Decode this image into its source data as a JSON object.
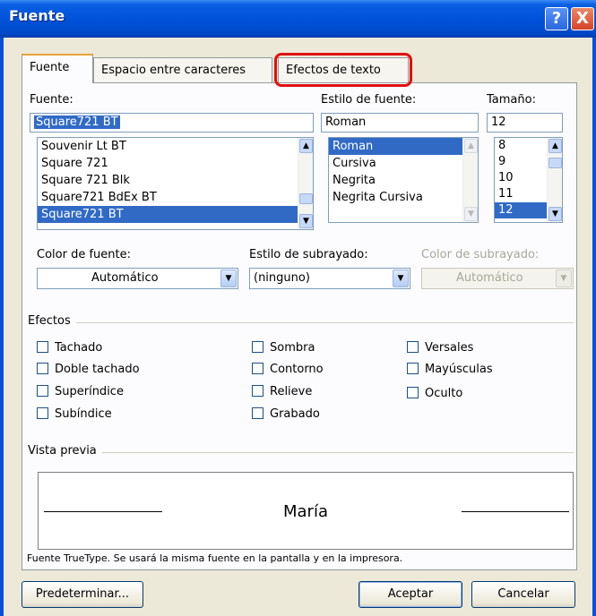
{
  "window": {
    "title": "Fuente"
  },
  "titlebar_buttons": {
    "help": "?",
    "close": "X"
  },
  "tabs": [
    {
      "label": "Fuente",
      "active": true
    },
    {
      "label": "Espacio entre caracteres",
      "active": false
    },
    {
      "label": "Efectos de texto",
      "active": false,
      "highlighted": true
    }
  ],
  "font": {
    "label": "Fuente:",
    "value": "Square721 BT",
    "items": [
      "Souvenir Lt BT",
      "Square 721",
      "Square 721 Blk",
      "Square721 BdEx BT",
      "Square721 BT"
    ],
    "selected": "Square721 BT"
  },
  "style": {
    "label": "Estilo de fuente:",
    "value": "Roman",
    "items": [
      "Roman",
      "Cursiva",
      "Negrita",
      "Negrita Cursiva"
    ],
    "selected": "Roman"
  },
  "size": {
    "label": "Tamaño:",
    "value": "12",
    "items": [
      "8",
      "9",
      "10",
      "11",
      "12"
    ],
    "selected": "12"
  },
  "font_color": {
    "label": "Color de fuente:",
    "value": "Automático"
  },
  "underline_style": {
    "label": "Estilo de subrayado:",
    "value": "(ninguno)"
  },
  "underline_color": {
    "label": "Color de subrayado:",
    "value": "Automático",
    "disabled": true
  },
  "effects": {
    "title": "Efectos",
    "items": [
      "Tachado",
      "Doble tachado",
      "Superíndice",
      "Subíndice",
      "Sombra",
      "Contorno",
      "Relieve",
      "Grabado",
      "Versales",
      "Mayúsculas",
      "Oculto"
    ]
  },
  "preview": {
    "title": "Vista previa",
    "sample": "María"
  },
  "footnote": "Fuente TrueType. Se usará la misma fuente en la pantalla y en la impresora.",
  "buttons": {
    "default": "Predeterminar...",
    "ok": "Aceptar",
    "cancel": "Cancelar"
  },
  "arrows": {
    "up": "▲",
    "down": "▼"
  },
  "colors": {
    "title_bar": "#0052d8",
    "selection": "#316ac5",
    "highlight_ring": "#e01010"
  }
}
